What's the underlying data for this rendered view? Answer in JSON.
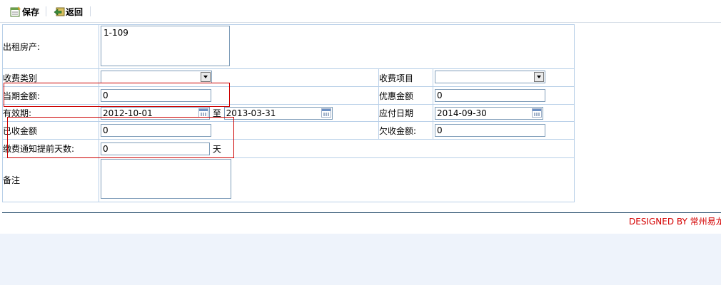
{
  "toolbar": {
    "save_label": "保存",
    "back_label": "返回"
  },
  "form": {
    "property_label": "出租房产:",
    "property_value": "1-109",
    "fee_category_label": "收费类别",
    "fee_item_label": "收费项目",
    "current_amount_label": "当期金额:",
    "current_amount_value": "0",
    "discount_label": "优惠金额",
    "discount_value": "0",
    "valid_period_label": "有效期:",
    "valid_from": "2012-10-01",
    "to_label": "至",
    "valid_to": "2013-03-31",
    "due_date_label": "应付日期",
    "due_date_value": "2014-09-30",
    "received_label": "已收金额",
    "received_value": "0",
    "owed_label": "欠收金额:",
    "owed_value": "0",
    "notice_days_label": "缴费通知提前天数:",
    "notice_days_value": "0",
    "days_unit": "天",
    "remark_label": "备注"
  },
  "footer": {
    "designed_by": "DESIGNED BY 常州易龙"
  },
  "colors": {
    "highlight_box": "#cc0000",
    "designed_text": "#d40000",
    "grid_border": "#b9d0e8"
  }
}
